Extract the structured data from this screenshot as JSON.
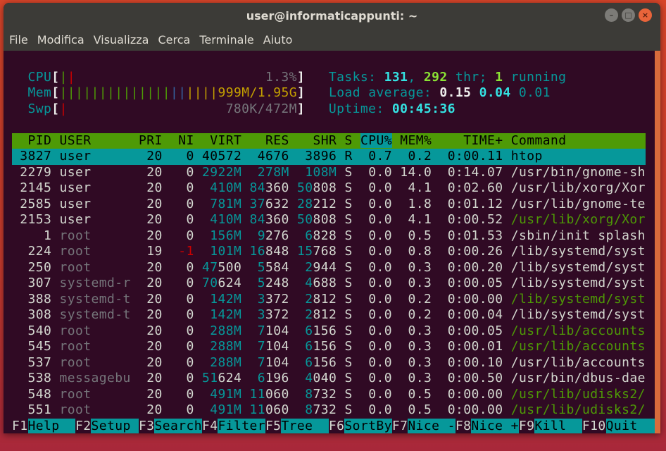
{
  "window": {
    "title": "user@informaticappunti: ~",
    "buttons": [
      "minimize",
      "maximize",
      "close"
    ]
  },
  "menu": [
    "File",
    "Modifica",
    "Visualizza",
    "Cerca",
    "Terminale",
    "Aiuto"
  ],
  "meters": {
    "cpu": {
      "label": "CPU",
      "value": "1.3%",
      "percent": 1.3
    },
    "mem": {
      "label": "Mem",
      "value": "999M/1.95G",
      "used": "999M",
      "total": "1.95G"
    },
    "swp": {
      "label": "Swp",
      "value": "780K/472M",
      "used": "780K",
      "total": "472M"
    }
  },
  "summary": {
    "tasks_label": "Tasks:",
    "tasks": "131",
    "thr": "292",
    "thr_label": "thr;",
    "running": "1",
    "running_label": "running",
    "load_label": "Load average:",
    "load1": "0.15",
    "load5": "0.04",
    "load15": "0.01",
    "uptime_label": "Uptime:",
    "uptime": "00:45:36"
  },
  "colors": {
    "header_bg": "#4e9a06",
    "selected_bg": "#06989a",
    "terminal_bg": "#300a24",
    "thread_cmd": "#4e9a06"
  },
  "columns": [
    "PID",
    "USER",
    "PRI",
    "NI",
    "VIRT",
    "RES",
    "SHR",
    "S",
    "CPU%",
    "MEM%",
    "TIME+",
    "Command"
  ],
  "sorted_column": "CPU%",
  "processes": [
    {
      "pid": "3827",
      "user": "user",
      "pri": "20",
      "ni": "0",
      "virt": "40572",
      "res": "4676",
      "shr": "3896",
      "s": "R",
      "cpu": "0.7",
      "mem": "0.2",
      "time": "0:00.11",
      "command": "htop",
      "selected": true
    },
    {
      "pid": "2279",
      "user": "user",
      "pri": "20",
      "ni": "0",
      "virt": "2922M",
      "res": "278M",
      "shr": "108M",
      "s": "S",
      "cpu": "0.0",
      "mem": "14.0",
      "time": "0:14.07",
      "command": "/usr/bin/gnome-sh"
    },
    {
      "pid": "2145",
      "user": "user",
      "pri": "20",
      "ni": "0",
      "virt": "410M",
      "res": "84360",
      "shr": "50808",
      "s": "S",
      "cpu": "0.0",
      "mem": "4.1",
      "time": "0:02.60",
      "command": "/usr/lib/xorg/Xor"
    },
    {
      "pid": "2585",
      "user": "user",
      "pri": "20",
      "ni": "0",
      "virt": "781M",
      "res": "37632",
      "shr": "28212",
      "s": "S",
      "cpu": "0.0",
      "mem": "1.8",
      "time": "0:01.12",
      "command": "/usr/lib/gnome-te"
    },
    {
      "pid": "2153",
      "user": "user",
      "pri": "20",
      "ni": "0",
      "virt": "410M",
      "res": "84360",
      "shr": "50808",
      "s": "S",
      "cpu": "0.0",
      "mem": "4.1",
      "time": "0:00.52",
      "command": "/usr/lib/xorg/Xor",
      "thread": true
    },
    {
      "pid": "1",
      "user": "root",
      "pri": "20",
      "ni": "0",
      "virt": "156M",
      "res": "9276",
      "shr": "6828",
      "s": "S",
      "cpu": "0.0",
      "mem": "0.5",
      "time": "0:01.53",
      "command": "/sbin/init splash"
    },
    {
      "pid": "224",
      "user": "root",
      "pri": "19",
      "ni": "-1",
      "virt": "101M",
      "res": "16848",
      "shr": "15768",
      "s": "S",
      "cpu": "0.0",
      "mem": "0.8",
      "time": "0:00.26",
      "command": "/lib/systemd/syst"
    },
    {
      "pid": "250",
      "user": "root",
      "pri": "20",
      "ni": "0",
      "virt": "47500",
      "res": "5584",
      "shr": "2944",
      "s": "S",
      "cpu": "0.0",
      "mem": "0.3",
      "time": "0:00.20",
      "command": "/lib/systemd/syst"
    },
    {
      "pid": "307",
      "user": "systemd-r",
      "pri": "20",
      "ni": "0",
      "virt": "70624",
      "res": "5248",
      "shr": "4688",
      "s": "S",
      "cpu": "0.0",
      "mem": "0.3",
      "time": "0:00.05",
      "command": "/lib/systemd/syst"
    },
    {
      "pid": "388",
      "user": "systemd-t",
      "pri": "20",
      "ni": "0",
      "virt": "142M",
      "res": "3372",
      "shr": "2812",
      "s": "S",
      "cpu": "0.0",
      "mem": "0.2",
      "time": "0:00.00",
      "command": "/lib/systemd/syst",
      "thread": true
    },
    {
      "pid": "308",
      "user": "systemd-t",
      "pri": "20",
      "ni": "0",
      "virt": "142M",
      "res": "3372",
      "shr": "2812",
      "s": "S",
      "cpu": "0.0",
      "mem": "0.2",
      "time": "0:00.04",
      "command": "/lib/systemd/syst"
    },
    {
      "pid": "540",
      "user": "root",
      "pri": "20",
      "ni": "0",
      "virt": "288M",
      "res": "7104",
      "shr": "6156",
      "s": "S",
      "cpu": "0.0",
      "mem": "0.3",
      "time": "0:00.05",
      "command": "/usr/lib/accounts",
      "thread": true
    },
    {
      "pid": "545",
      "user": "root",
      "pri": "20",
      "ni": "0",
      "virt": "288M",
      "res": "7104",
      "shr": "6156",
      "s": "S",
      "cpu": "0.0",
      "mem": "0.3",
      "time": "0:00.01",
      "command": "/usr/lib/accounts",
      "thread": true
    },
    {
      "pid": "537",
      "user": "root",
      "pri": "20",
      "ni": "0",
      "virt": "288M",
      "res": "7104",
      "shr": "6156",
      "s": "S",
      "cpu": "0.0",
      "mem": "0.3",
      "time": "0:00.10",
      "command": "/usr/lib/accounts"
    },
    {
      "pid": "538",
      "user": "messagebu",
      "pri": "20",
      "ni": "0",
      "virt": "51624",
      "res": "6196",
      "shr": "4040",
      "s": "S",
      "cpu": "0.0",
      "mem": "0.3",
      "time": "0:00.50",
      "command": "/usr/bin/dbus-dae"
    },
    {
      "pid": "548",
      "user": "root",
      "pri": "20",
      "ni": "0",
      "virt": "491M",
      "res": "11060",
      "shr": "8732",
      "s": "S",
      "cpu": "0.0",
      "mem": "0.5",
      "time": "0:00.00",
      "command": "/usr/lib/udisks2/",
      "thread": true
    },
    {
      "pid": "551",
      "user": "root",
      "pri": "20",
      "ni": "0",
      "virt": "491M",
      "res": "11060",
      "shr": "8732",
      "s": "S",
      "cpu": "0.0",
      "mem": "0.5",
      "time": "0:00.00",
      "command": "/usr/lib/udisks2/",
      "thread": true
    }
  ],
  "function_keys": [
    {
      "key": "F1",
      "label": "Help"
    },
    {
      "key": "F2",
      "label": "Setup"
    },
    {
      "key": "F3",
      "label": "Search"
    },
    {
      "key": "F4",
      "label": "Filter"
    },
    {
      "key": "F5",
      "label": "Tree"
    },
    {
      "key": "F6",
      "label": "SortBy"
    },
    {
      "key": "F7",
      "label": "Nice -"
    },
    {
      "key": "F8",
      "label": "Nice +"
    },
    {
      "key": "F9",
      "label": "Kill"
    },
    {
      "key": "F10",
      "label": "Quit"
    }
  ]
}
